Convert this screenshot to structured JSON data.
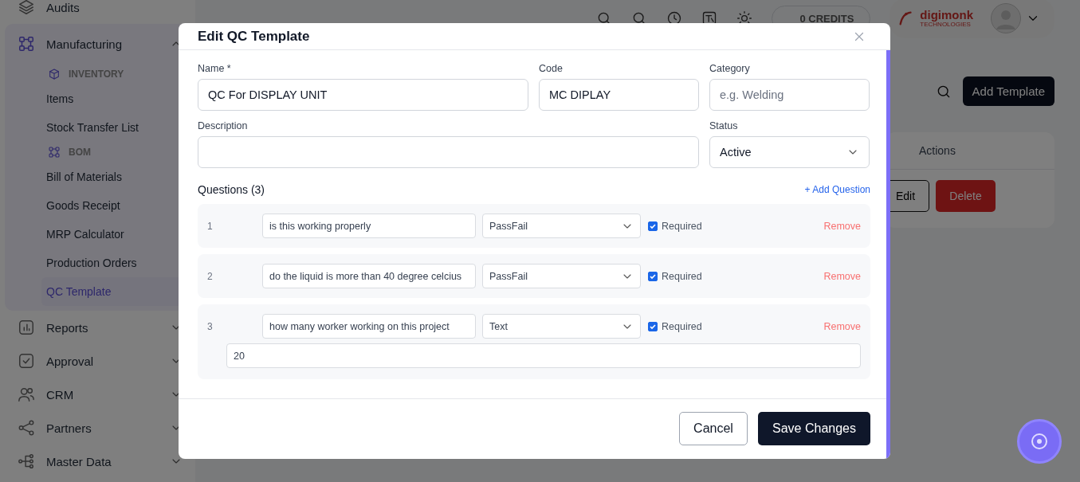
{
  "sidebar": {
    "items": [
      {
        "label": "Audits",
        "expanded": false,
        "has_caret": false
      },
      {
        "label": "Manufacturing",
        "expanded": true,
        "has_caret": true,
        "sections": [
          {
            "heading": "INVENTORY",
            "items": [
              {
                "label": "Items",
                "selected": false
              },
              {
                "label": "Stock Transfer List",
                "selected": false
              }
            ]
          },
          {
            "heading": "BOM",
            "items": [
              {
                "label": "Bill of Materials",
                "selected": false
              },
              {
                "label": "Goods Receipt",
                "selected": false
              },
              {
                "label": "MRP Calculator",
                "selected": false
              },
              {
                "label": "Production Orders",
                "selected": false
              },
              {
                "label": "QC Template",
                "selected": true
              }
            ]
          }
        ]
      },
      {
        "label": "Reports",
        "expanded": false,
        "has_caret": true
      },
      {
        "label": "Approval",
        "expanded": false,
        "has_caret": true
      },
      {
        "label": "CRM",
        "expanded": false,
        "has_caret": true
      },
      {
        "label": "Partners",
        "expanded": false,
        "has_caret": true
      },
      {
        "label": "Master Data",
        "expanded": false,
        "has_caret": true
      }
    ]
  },
  "header": {
    "credits": "0 CREDITS",
    "logo": {
      "name": "digimonk",
      "tagline": "TECHNOLOGIES"
    }
  },
  "page": {
    "add_button": "Add Template",
    "table": {
      "columns": [
        "Actions"
      ],
      "row_actions": [
        "Edit",
        "Delete"
      ]
    }
  },
  "modal": {
    "title": "Edit QC Template",
    "fields": [
      {
        "label": "Name *",
        "value": "QC For DISPLAY UNIT"
      },
      {
        "label": "Code",
        "value": "MC DIPLAY"
      },
      {
        "label": "Category",
        "placeholder": "e.g. Welding"
      }
    ],
    "description": {
      "label": "Description"
    },
    "status": {
      "label": "Status",
      "value": "Active"
    },
    "questions_heading": "Questions (3)",
    "add_question": "+ Add Question",
    "questions": [
      {
        "number": "1",
        "text": "is this working properly",
        "type": "PassFail",
        "required": true,
        "required_label": "Required",
        "remove": "Remove"
      },
      {
        "number": "2",
        "text": "do the liquid is more than 40 degree celcius",
        "type": "PassFail",
        "required": true,
        "required_label": "Required",
        "remove": "Remove"
      },
      {
        "number": "3",
        "text": "how many worker working on this project",
        "type": "Text",
        "required": true,
        "required_label": "Required",
        "remove": "Remove",
        "answer": "20"
      }
    ],
    "buttons": {
      "cancel": "Cancel",
      "save": "Save Changes"
    }
  }
}
